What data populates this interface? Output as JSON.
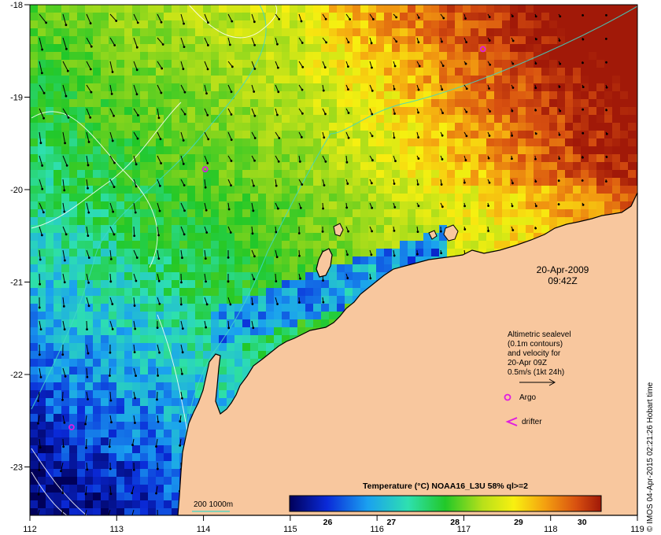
{
  "map": {
    "lon_ticks": [
      "112",
      "113",
      "114",
      "115",
      "116",
      "117",
      "118",
      "119"
    ],
    "lat_ticks": [
      "-18",
      "-19",
      "-20",
      "-21",
      "-22",
      "-23"
    ],
    "date": "20-Apr-2009",
    "time": "09:42Z",
    "legend_lines": [
      "Altimetric sealevel",
      "(0.1m contours)",
      "and velocity for",
      "20-Apr 09Z",
      "0.5m/s (1kt 24h)"
    ],
    "argo_label": "Argo",
    "drifter_label": "drifter",
    "depth_label": "200  1000m",
    "colorbar": {
      "title": "Temperature (°C) NOAA16_L3U 58% ql>=2",
      "ticks": [
        "26",
        "27",
        "28",
        "29",
        "30"
      ],
      "range": [
        25.4,
        30.3
      ]
    },
    "credit": "© IMOS 04-Apr-2015 02:21:26 Hobart time",
    "colors": {
      "land": "#F8C79E",
      "depth_contour": "#3FD7C8",
      "argo": "#E01CE0",
      "arrow": "#000000"
    },
    "argo_floats": [
      {
        "lon": 114.02,
        "lat": -19.78
      },
      {
        "lon": 112.48,
        "lat": -22.57
      },
      {
        "lon": 117.22,
        "lat": -18.48
      }
    ]
  }
}
